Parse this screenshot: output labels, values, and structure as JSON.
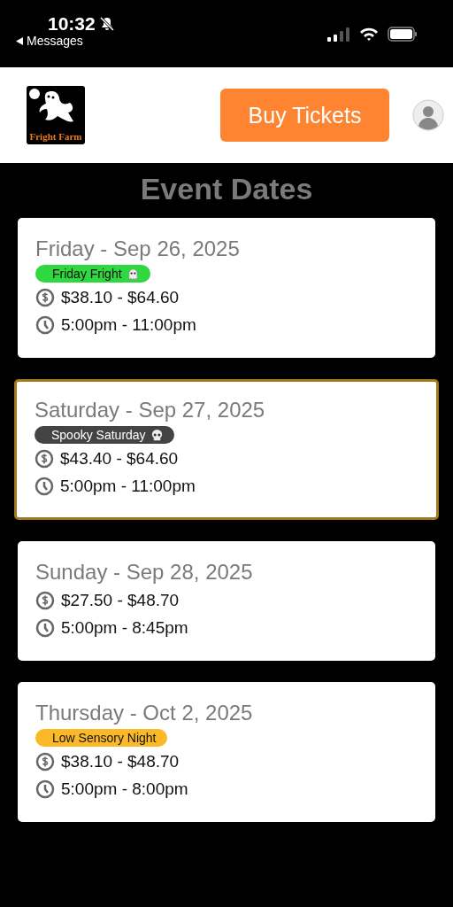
{
  "status_bar": {
    "time": "10:32",
    "back_label": "Messages"
  },
  "header": {
    "logo_text": "Fright Farm",
    "button": "Buy Tickets"
  },
  "title": "Event Dates",
  "events": [
    {
      "date": "Friday - Sep 26, 2025",
      "selected": false,
      "tag": {
        "label": "Friday Fright",
        "color": "#2fd83f",
        "kind": "ghost"
      },
      "price": "$38.10 - $64.60",
      "time": "5:00pm - 11:00pm"
    },
    {
      "date": "Saturday - Sep 27, 2025",
      "selected": true,
      "tag": {
        "label": "Spooky Saturday",
        "color": "#444444",
        "kind": "skull"
      },
      "price": "$43.40 - $64.60",
      "time": "5:00pm - 11:00pm"
    },
    {
      "date": "Sunday - Sep 28, 2025",
      "selected": false,
      "price": "$27.50 - $48.70",
      "time": "5:00pm - 8:45pm"
    },
    {
      "date": "Thursday - Oct 2, 2025",
      "selected": false,
      "tag": {
        "label": "Low Sensory Night",
        "color": "#fbb829",
        "kind": "plain"
      },
      "price": "$38.10 - $48.70",
      "time": "5:00pm - 8:00pm"
    }
  ]
}
